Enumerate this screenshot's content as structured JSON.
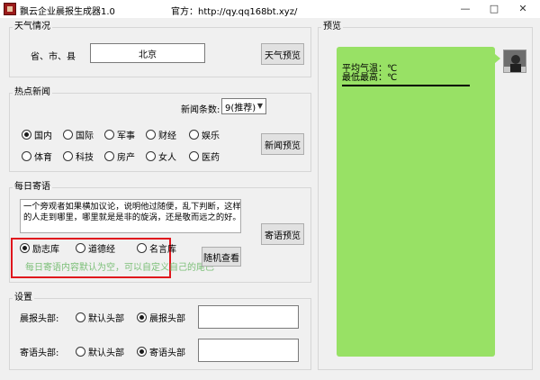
{
  "window": {
    "title": "飘云企业晨报生成器1.0",
    "url_text": "官方：http://qy.qq168bt.xyz/",
    "minimize": "—",
    "maximize": "□",
    "close": "✕"
  },
  "weather": {
    "group_title": "天气情况",
    "location_label": "省、市、县",
    "location_value": "北京",
    "preview_button": "天气预览"
  },
  "news": {
    "group_title": "热点新闻",
    "count_label": "新闻条数:",
    "count_value": "9(推荐)",
    "categories": [
      {
        "label": "国内",
        "checked": true
      },
      {
        "label": "国际",
        "checked": false
      },
      {
        "label": "军事",
        "checked": false
      },
      {
        "label": "财经",
        "checked": false
      },
      {
        "label": "娱乐",
        "checked": false
      },
      {
        "label": "体育",
        "checked": false
      },
      {
        "label": "科技",
        "checked": false
      },
      {
        "label": "房产",
        "checked": false
      },
      {
        "label": "女人",
        "checked": false
      },
      {
        "label": "医药",
        "checked": false
      }
    ],
    "preview_button": "新闻预览"
  },
  "daily": {
    "group_title": "每日寄语",
    "text_line1": "一个旁观者如果横加议论，说明他过随便，乱下判断，这样",
    "text_line2": "的人走到哪里，哪里就是是非的旋涡，还是敬而远之的好。",
    "sources": [
      {
        "label": "励志库",
        "checked": true
      },
      {
        "label": "道德经",
        "checked": false
      },
      {
        "label": "名言库",
        "checked": false
      }
    ],
    "hint": "每日寄语内容默认为空，可以自定义自己的尾巴",
    "random_button": "随机查看",
    "preview_button": "寄语预览",
    "highlight_color": "#e0161d"
  },
  "settings": {
    "group_title": "设置",
    "morning_label": "晨报头部:",
    "morning_options": [
      {
        "label": "默认头部",
        "checked": false
      },
      {
        "label": "晨报头部",
        "checked": true
      }
    ],
    "morning_value": "",
    "daily_label": "寄语头部:",
    "daily_options": [
      {
        "label": "默认头部",
        "checked": false
      },
      {
        "label": "寄语头部",
        "checked": true
      }
    ],
    "daily_value": ""
  },
  "preview": {
    "group_title": "预览",
    "line1": "平均气温：℃",
    "line2": "最低最高：℃",
    "bubble_color": "#98e165"
  }
}
